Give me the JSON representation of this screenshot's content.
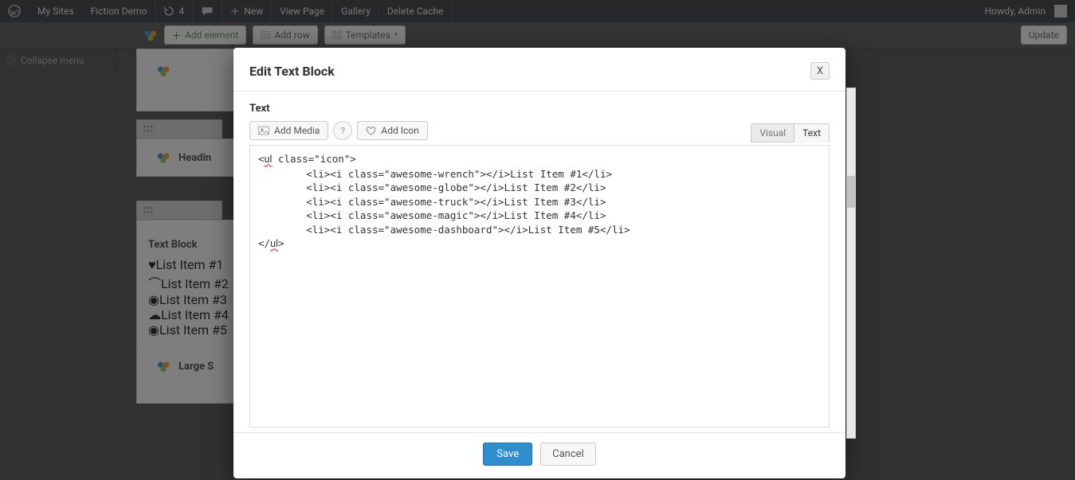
{
  "admin_bar": {
    "my_sites": "My Sites",
    "site_name": "Fiction Demo",
    "refresh_count": "4",
    "new_label": "New",
    "view_page": "View Page",
    "gallery": "Gallery",
    "delete_cache": "Delete Cache",
    "howdy": "Howdy, Admin"
  },
  "sec_toolbar": {
    "add_element": "Add element",
    "add_row": "Add row",
    "templates": "Templates",
    "update": "Update"
  },
  "collapse_menu": "Collapse menu",
  "bg_elements": {
    "heading": "Headin",
    "text_block_title": "Text Block",
    "items": [
      "List Item #1",
      "List Item #2",
      "List Item #3",
      "List Item #4",
      "List Item #5"
    ],
    "large": "Large S"
  },
  "modal": {
    "title": "Edit Text Block",
    "field_label": "Text",
    "add_media": "Add Media",
    "add_icon": "Add Icon",
    "tab_visual": "Visual",
    "tab_text": "Text",
    "code": "<ul class=\"icon\">\n        <li><i class=\"awesome-wrench\"></i>List Item #1</li>\n        <li><i class=\"awesome-globe\"></i>List Item #2</li>\n        <li><i class=\"awesome-truck\"></i>List Item #3</li>\n        <li><i class=\"awesome-magic\"></i>List Item #4</li>\n        <li><i class=\"awesome-dashboard\"></i>List Item #5</li>\n</ul>",
    "save": "Save",
    "cancel": "Cancel",
    "close": "X"
  }
}
